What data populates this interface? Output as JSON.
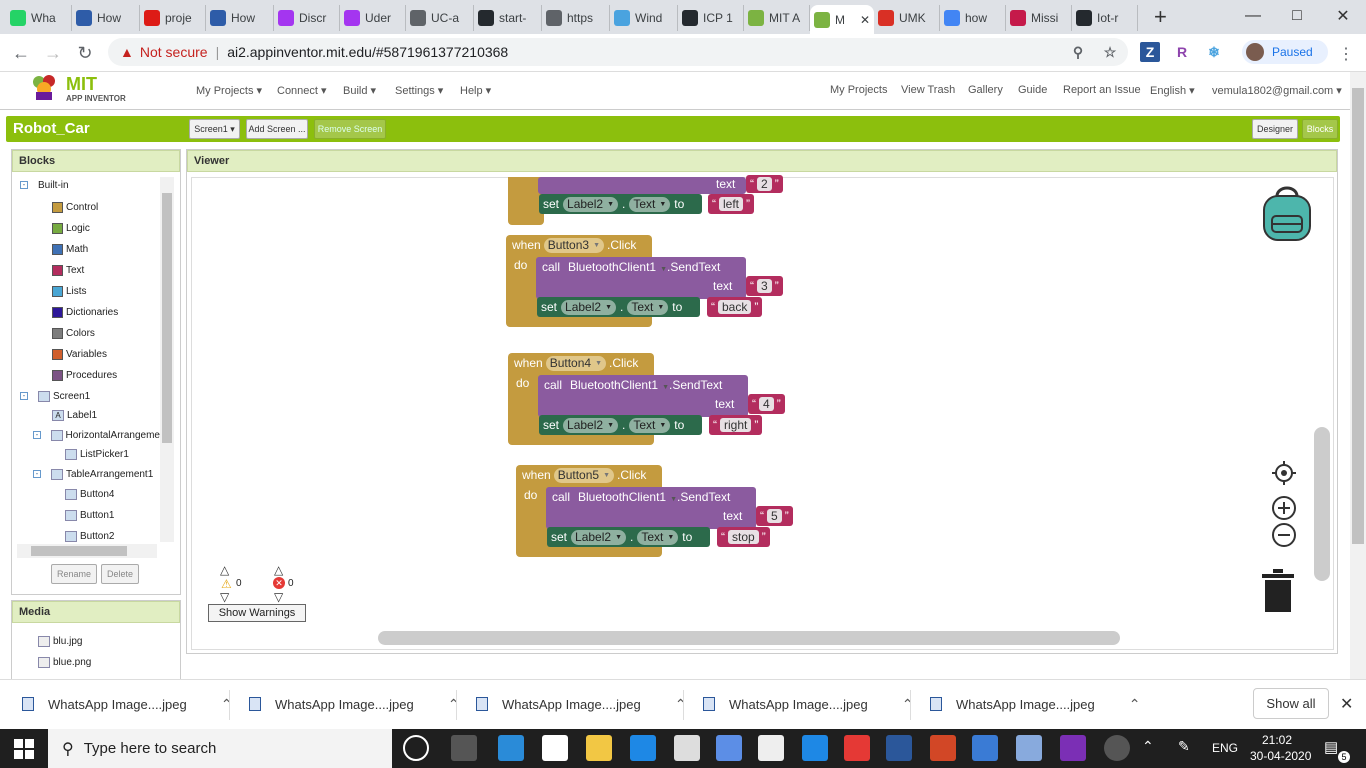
{
  "browser": {
    "tabs": [
      {
        "label": "Wha",
        "icon": "whatsapp-icon",
        "color": "#25d366"
      },
      {
        "label": "How",
        "icon": "hackster-icon",
        "color": "#2e5ca8"
      },
      {
        "label": "proje",
        "icon": "angular-icon",
        "color": "#dd1b16"
      },
      {
        "label": "How",
        "icon": "hackster-icon",
        "color": "#2e5ca8"
      },
      {
        "label": "Discr",
        "icon": "udemy-icon",
        "color": "#a435f0"
      },
      {
        "label": "Uder",
        "icon": "udemy-icon",
        "color": "#a435f0"
      },
      {
        "label": "UC-a",
        "icon": "globe-icon",
        "color": "#5f6368"
      },
      {
        "label": "start-",
        "icon": "github-icon",
        "color": "#24292e"
      },
      {
        "label": "https",
        "icon": "globe-icon",
        "color": "#5f6368"
      },
      {
        "label": "Wind",
        "icon": "windows-icon",
        "color": "#4aa3df"
      },
      {
        "label": "ICP 1",
        "icon": "github-icon",
        "color": "#24292e"
      },
      {
        "label": "MIT A",
        "icon": "appinventor-icon",
        "color": "#7cb342"
      },
      {
        "label": "M",
        "icon": "appinventor-icon",
        "color": "#7cb342",
        "active": true
      },
      {
        "label": "UMK",
        "icon": "gmail-icon",
        "color": "#d93025"
      },
      {
        "label": "how",
        "icon": "google-icon",
        "color": "#4285f4"
      },
      {
        "label": "Missi",
        "icon": "raspberry-icon",
        "color": "#c51a4a"
      },
      {
        "label": "Iot-r",
        "icon": "github-icon",
        "color": "#24292e"
      }
    ],
    "new_tab": "+",
    "address": {
      "warning": "Not secure",
      "separator": "|",
      "url": "ai2.appinventor.mit.edu/#5871961377210368"
    },
    "profile_status": "Paused"
  },
  "app": {
    "logo_title": "MIT",
    "logo_subtitle": "APP INVENTOR",
    "menu_left": [
      "My Projects ▾",
      "Connect ▾",
      "Build ▾",
      "Settings ▾",
      "Help ▾"
    ],
    "menu_right": [
      "My Projects",
      "View Trash",
      "Gallery",
      "Guide",
      "Report an Issue",
      "English ▾",
      "vemula1802@gmail.com ▾"
    ],
    "project_name": "Robot_Car",
    "screen_select": "Screen1 ▾",
    "add_screen": "Add Screen ...",
    "remove_screen": "Remove Screen",
    "designer": "Designer",
    "blocks": "Blocks"
  },
  "blocks_panel": {
    "title": "Blocks",
    "builtin_label": "Built-in",
    "builtin": [
      {
        "label": "Control",
        "color": "#c49b3f"
      },
      {
        "label": "Logic",
        "color": "#77ab41"
      },
      {
        "label": "Math",
        "color": "#3f71b5"
      },
      {
        "label": "Text",
        "color": "#b32d5e"
      },
      {
        "label": "Lists",
        "color": "#49a6d4"
      },
      {
        "label": "Dictionaries",
        "color": "#2d1799"
      },
      {
        "label": "Colors",
        "color": "#7d7d7d"
      },
      {
        "label": "Variables",
        "color": "#d05f2d"
      },
      {
        "label": "Procedures",
        "color": "#7c5385"
      }
    ],
    "components": [
      "Screen1",
      "Label1",
      "HorizontalArrangeme",
      "ListPicker1",
      "TableArrangement1",
      "Button4",
      "Button1",
      "Button2"
    ],
    "rename": "Rename",
    "delete": "Delete"
  },
  "media": {
    "title": "Media",
    "files": [
      "blu.jpg",
      "blue.png"
    ]
  },
  "viewer": {
    "title": "Viewer",
    "warnings_count": "0",
    "errors_count": "0",
    "show_warnings": "Show Warnings",
    "partial_block": {
      "text_label": "text",
      "text_value": "2",
      "set_label": "set",
      "component": "Label2",
      "dot": ".",
      "prop": "Text",
      "to": "to",
      "value": "left"
    },
    "events": [
      {
        "when": "when",
        "button": "Button3",
        "event": ".Click",
        "do": "do",
        "call": "call",
        "client": "BluetoothClient1",
        "method": ".SendText",
        "text_label": "text",
        "text_value": "3",
        "set": "set",
        "component": "Label2",
        "dot": ".",
        "prop": "Text",
        "to": "to",
        "value": "back"
      },
      {
        "when": "when",
        "button": "Button4",
        "event": ".Click",
        "do": "do",
        "call": "call",
        "client": "BluetoothClient1",
        "method": ".SendText",
        "text_label": "text",
        "text_value": "4",
        "set": "set",
        "component": "Label2",
        "dot": ".",
        "prop": "Text",
        "to": "to",
        "value": "right"
      },
      {
        "when": "when",
        "button": "Button5",
        "event": ".Click",
        "do": "do",
        "call": "call",
        "client": "BluetoothClient1",
        "method": ".SendText",
        "text_label": "text",
        "text_value": "5",
        "set": "set",
        "component": "Label2",
        "dot": ".",
        "prop": "Text",
        "to": "to",
        "value": "stop"
      }
    ]
  },
  "downloads": {
    "files": [
      "WhatsApp Image....jpeg",
      "WhatsApp Image....jpeg",
      "WhatsApp Image....jpeg",
      "WhatsApp Image....jpeg",
      "WhatsApp Image....jpeg"
    ],
    "show_all": "Show all"
  },
  "taskbar": {
    "search_placeholder": "Type here to search",
    "language": "ENG",
    "time": "21:02",
    "date": "30-04-2020",
    "notif_count": "5"
  }
}
